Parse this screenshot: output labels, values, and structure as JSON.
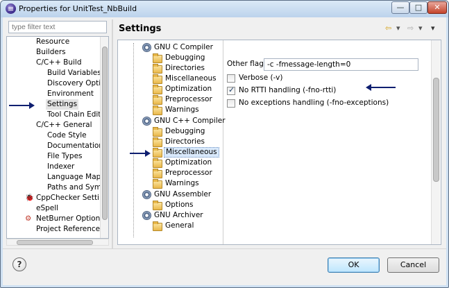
{
  "window": {
    "title": "Properties for UnitTest_NbBuild",
    "min_glyph": "—",
    "max_glyph": "□",
    "close_glyph": "✕"
  },
  "filter": {
    "placeholder": "type filter text"
  },
  "nav": {
    "items": [
      {
        "label": "Resource"
      },
      {
        "label": "Builders"
      },
      {
        "label": "C/C++ Build"
      },
      {
        "label": "Build Variables"
      },
      {
        "label": "Discovery Optior"
      },
      {
        "label": "Environment"
      },
      {
        "label": "Settings",
        "selected": true
      },
      {
        "label": "Tool Chain Edito"
      },
      {
        "label": "C/C++ General"
      },
      {
        "label": "Code Style"
      },
      {
        "label": "Documentation"
      },
      {
        "label": "File Types"
      },
      {
        "label": "Indexer"
      },
      {
        "label": "Language Mapp"
      },
      {
        "label": "Paths and Symbo"
      },
      {
        "label": "CppChecker Setting"
      },
      {
        "label": "eSpell"
      },
      {
        "label": "NetBurner Options"
      },
      {
        "label": "Project References"
      }
    ]
  },
  "page": {
    "title": "Settings",
    "nav_back": "⇦",
    "nav_dropdown": "▾",
    "nav_forward": "⇨",
    "nav_menu": "▾"
  },
  "tool_tree": {
    "items": [
      {
        "label": "GNU C Compiler",
        "kind": "tool"
      },
      {
        "label": "Debugging",
        "kind": "category"
      },
      {
        "label": "Directories",
        "kind": "category"
      },
      {
        "label": "Miscellaneous",
        "kind": "category"
      },
      {
        "label": "Optimization",
        "kind": "category"
      },
      {
        "label": "Preprocessor",
        "kind": "category"
      },
      {
        "label": "Warnings",
        "kind": "category"
      },
      {
        "label": "GNU C++ Compiler",
        "kind": "tool"
      },
      {
        "label": "Debugging",
        "kind": "category"
      },
      {
        "label": "Directories",
        "kind": "category"
      },
      {
        "label": "Miscellaneous",
        "kind": "category",
        "selected": true
      },
      {
        "label": "Optimization",
        "kind": "category"
      },
      {
        "label": "Preprocessor",
        "kind": "category"
      },
      {
        "label": "Warnings",
        "kind": "category"
      },
      {
        "label": "GNU Assembler",
        "kind": "tool"
      },
      {
        "label": "Options",
        "kind": "category"
      },
      {
        "label": "GNU Archiver",
        "kind": "tool"
      },
      {
        "label": "General",
        "kind": "category"
      }
    ]
  },
  "options": {
    "other_flags_label": "Other flags",
    "other_flags_value": "-c -fmessage-length=0",
    "checkboxes": [
      {
        "label": "Verbose (-v)",
        "checked": false
      },
      {
        "label": "No RTTI handling (-fno-rtti)",
        "checked": true
      },
      {
        "label": "No exceptions handling (-fno-exceptions)",
        "checked": false
      }
    ]
  },
  "footer": {
    "help_glyph": "?",
    "ok_label": "OK",
    "cancel_label": "Cancel"
  },
  "colors": {
    "annotation_arrow": "#0f1f70",
    "selection": "#d9e9fb"
  }
}
